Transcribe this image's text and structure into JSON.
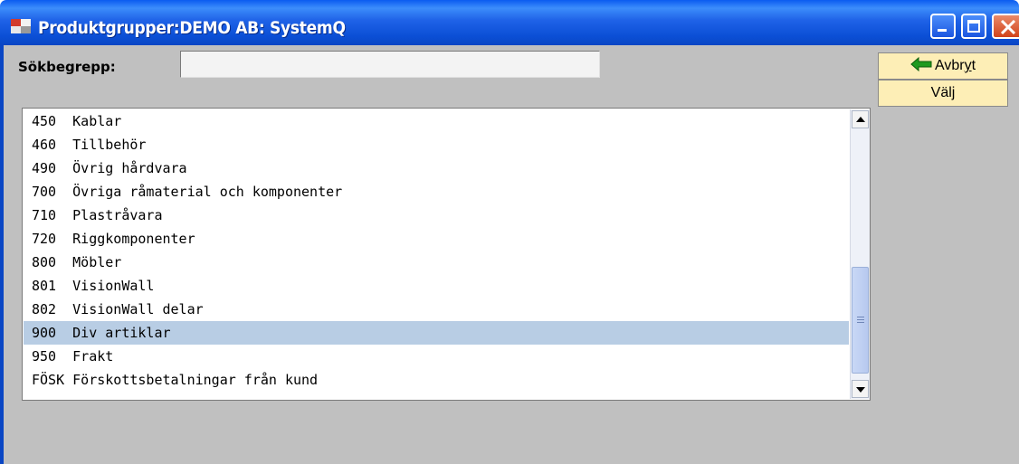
{
  "window": {
    "title": "Produktgrupper:DEMO AB: SystemQ",
    "icon": "application-icon",
    "controls": [
      "minimize-icon",
      "maximize-icon",
      "close-icon"
    ]
  },
  "search": {
    "label": "Sökbegrepp:",
    "value": "",
    "placeholder": ""
  },
  "buttons": {
    "cancel": {
      "prefix": "Avbr",
      "underline": "y",
      "suffix": "t",
      "icon": "arrow-left-icon"
    },
    "select": {
      "label": "Välj"
    }
  },
  "list": {
    "selected_index": 9,
    "items": [
      {
        "code": "450 ",
        "name": "Kablar"
      },
      {
        "code": "460 ",
        "name": "Tillbehör"
      },
      {
        "code": "490 ",
        "name": "Övrig hårdvara"
      },
      {
        "code": "700 ",
        "name": "Övriga råmaterial och komponenter"
      },
      {
        "code": "710 ",
        "name": "Plastråvara"
      },
      {
        "code": "720 ",
        "name": "Riggkomponenter"
      },
      {
        "code": "800 ",
        "name": "Möbler"
      },
      {
        "code": "801 ",
        "name": "VisionWall"
      },
      {
        "code": "802 ",
        "name": "VisionWall delar"
      },
      {
        "code": "900 ",
        "name": "Div artiklar"
      },
      {
        "code": "950 ",
        "name": "Frakt"
      },
      {
        "code": "FÖSK",
        "name": "Förskottsbetalningar från kund"
      }
    ]
  },
  "colors": {
    "titlebar": "#0a5bf0",
    "client_background": "#c0c0c0",
    "button_background": "#fdeeb6",
    "selection": "#b8cde4",
    "arrow_icon": "#1f9a1f"
  }
}
